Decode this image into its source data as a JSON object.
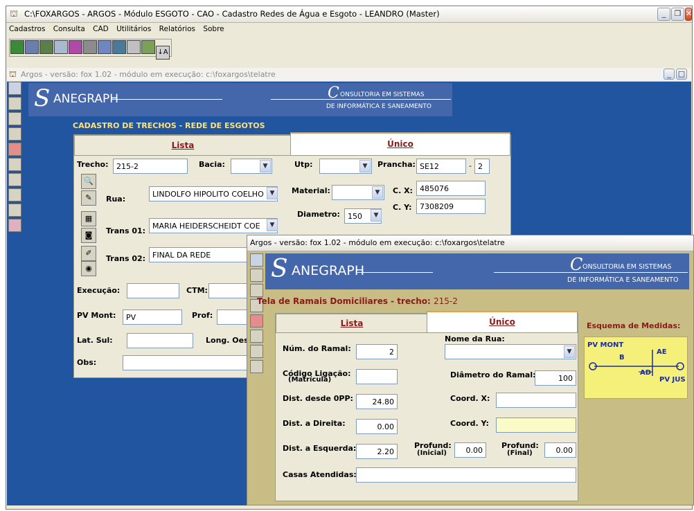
{
  "window": {
    "title": "C:\\FOXARGOS - ARGOS - Módulo ESGOTO - CAO - Cadastro Redes de Água e Esgoto - LEANDRO (Master)",
    "menu": [
      "Cadastros",
      "Consulta",
      "CAD",
      "Utilitários",
      "Relatórios",
      "Sobre"
    ]
  },
  "mdi": {
    "title": "Argos - versão: fox 1.02 - módulo em execução: c:\\foxargos\\telatre"
  },
  "banner": {
    "logo": "ANEGRAPH",
    "logo_initial": "S",
    "consult_initial": "C",
    "consult_line1": "ONSULTORIA EM SISTEMAS",
    "consult_line2": "DE INFORMÁTICA E SANEAMENTO"
  },
  "trechos": {
    "heading": "CADASTRO DE TRECHOS - REDE DE ESGOTOS",
    "tab_lista": "Lista",
    "tab_unico": "Único",
    "trecho_label": "Trecho:",
    "trecho_value": "215-2",
    "bacia_label": "Bacia:",
    "utp_label": "Utp:",
    "prancha_label": "Prancha:",
    "prancha_value": "SE12",
    "prancha_suffix": "2",
    "rua_label": "Rua:",
    "rua_value": "LINDOLFO HIPOLITO COELHO",
    "material_label": "Material:",
    "cx_label": "C. X:",
    "cx_value": "485076",
    "cy_label": "C. Y:",
    "cy_value": "7308209",
    "diametro_label": "Diametro:",
    "diametro_value": "150",
    "trans01_label": "Trans 01:",
    "trans01_value": "MARIA HEIDERSCHEIDT COE",
    "trans02_label": "Trans 02:",
    "trans02_value": "FINAL DA REDE",
    "execucao_label": "Execução:",
    "ctm_label": "CTM:",
    "pvmont_label": "PV Mont:",
    "pvmont_value": "PV",
    "prof_label": "Prof:",
    "latsul_label": "Lat. Sul:",
    "longoeste_label": "Long. Oeste",
    "obs_label": "Obs:"
  },
  "ramais": {
    "title": "Argos - versão: fox 1.02 - módulo em execução: c:\\foxargos\\telatre",
    "heading": "Tela de Ramais Domiciliares - trecho:",
    "heading_value": "215-2",
    "tab_lista": "Lista",
    "tab_unico": "Único",
    "num_ramal_label": "Núm. do Ramal:",
    "num_ramal_value": "2",
    "nome_rua_label": "Nome da Rua:",
    "codigo_label": "Código Ligação:",
    "codigo_sub": "(Matrícula)",
    "diametro_ramal_label": "Diâmetro do Ramal:",
    "diametro_ramal_value": "100",
    "dist_opp_label": "Dist. desde 0PP:",
    "dist_opp_value": "24.80",
    "coordx_label": "Coord. X:",
    "dist_direita_label": "Dist. a Direita:",
    "dist_direita_value": "0.00",
    "coordy_label": "Coord. Y:",
    "dist_esquerda_label": "Dist. a Esquerda:",
    "dist_esquerda_value": "2.20",
    "prof_inicial_label": "Profund:",
    "prof_inicial_sub": "(Inicial)",
    "prof_inicial_value": "0.00",
    "prof_final_label": "Profund:",
    "prof_final_sub": "(Final)",
    "prof_final_value": "0.00",
    "casas_label": "Casas Atendidas:",
    "esquema_label": "Esquema de Medidas:",
    "esquema": {
      "pv_mont": "PV MONT",
      "b": "B",
      "ae": "AE",
      "ad": "AD",
      "pv_jus": "PV JUS"
    }
  },
  "colors": {
    "desktop": "#2255a0",
    "banner": "#4466aa",
    "heading": "#ffe27a",
    "tab_text": "#8b1a1a",
    "ramais_bg": "#c9bd86",
    "highlight_input": "#fbfbc8",
    "esquema_bg": "#f4f07a"
  }
}
